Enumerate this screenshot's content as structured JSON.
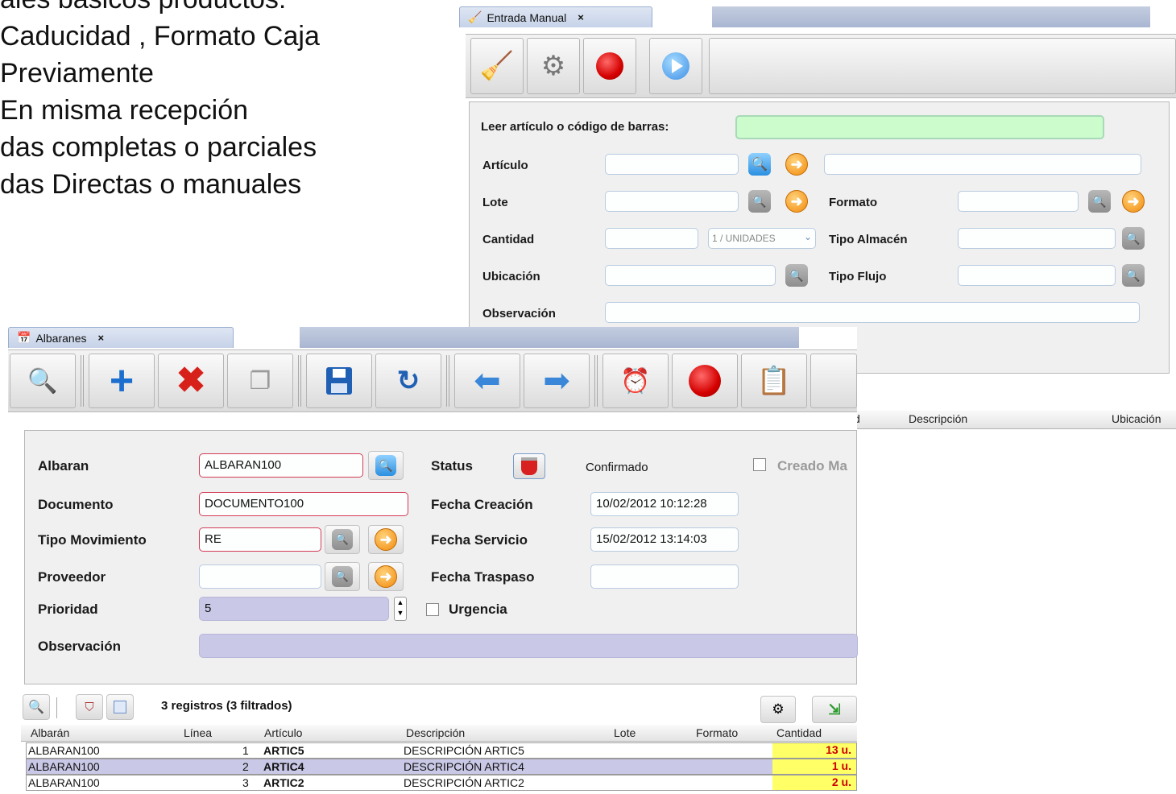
{
  "slide": {
    "lines": [
      "ales básicos productos:",
      " Caducidad , Formato Caja",
      "Previamente",
      "En misma recepción",
      "das completas o parciales",
      "das Directas o manuales"
    ]
  },
  "entrada": {
    "tab_label": "Entrada Manual",
    "tab_close": "×",
    "barcode_label": "Leer artículo o código de barras:",
    "articulo_label": "Artículo",
    "lote_label": "Lote",
    "formato_label": "Formato",
    "cantidad_label": "Cantidad",
    "unit_select": "1 / UNIDADES",
    "tipo_almacen_label": "Tipo Almacén",
    "ubicacion_label": "Ubicación",
    "tipo_flujo_label": "Tipo Flujo",
    "observacion_label": "Observación",
    "grid_headers": [
      "d",
      "Descripción",
      "Ubicación"
    ]
  },
  "albaranes": {
    "tab_label": "Albaranes",
    "tab_close": "×",
    "albaran_label": "Albaran",
    "albaran_value": "ALBARAN100",
    "status_label": "Status",
    "status_value": "Confirmado",
    "creado_label": "Creado Ma",
    "documento_label": "Documento",
    "documento_value": "DOCUMENTO100",
    "fecha_creacion_label": "Fecha Creación",
    "fecha_creacion_value": "10/02/2012 10:12:28",
    "tipo_mov_label": "Tipo Movimiento",
    "tipo_mov_value": "RE",
    "fecha_servicio_label": "Fecha Servicio",
    "fecha_servicio_value": "15/02/2012 13:14:03",
    "proveedor_label": "Proveedor",
    "proveedor_value": "",
    "fecha_traspaso_label": "Fecha Traspaso",
    "fecha_traspaso_value": "",
    "prioridad_label": "Prioridad",
    "prioridad_value": "5",
    "urgencia_label": "Urgencia",
    "observacion_label": "Observación",
    "records_text": "3 registros (3 filtrados)",
    "grid_headers": [
      "Albarán",
      "Línea",
      "Artículo",
      "Descripción",
      "Lote",
      "Formato",
      "Cantidad"
    ],
    "rows": [
      {
        "albaran": "ALBARAN100",
        "linea": "1",
        "articulo": "ARTIC5",
        "descripcion": "DESCRIPCIÓN ARTIC5",
        "lote": "",
        "formato": "",
        "cantidad": "13 u."
      },
      {
        "albaran": "ALBARAN100",
        "linea": "2",
        "articulo": "ARTIC4",
        "descripcion": "DESCRIPCIÓN ARTIC4",
        "lote": "",
        "formato": "",
        "cantidad": "1 u."
      },
      {
        "albaran": "ALBARAN100",
        "linea": "3",
        "articulo": "ARTIC2",
        "descripcion": "DESCRIPCIÓN ARTIC2",
        "lote": "",
        "formato": "",
        "cantidad": "2 u."
      }
    ]
  },
  "colors": {
    "tab_bg": "#c6d2e8",
    "required_border": "#d23b55",
    "readonly_bg": "#c9c8e6",
    "barcode_bg": "#ccfbcc",
    "selected_row": "#c9c8e6",
    "qty_bg": "#ffff66",
    "qty_text": "#cc0000"
  }
}
